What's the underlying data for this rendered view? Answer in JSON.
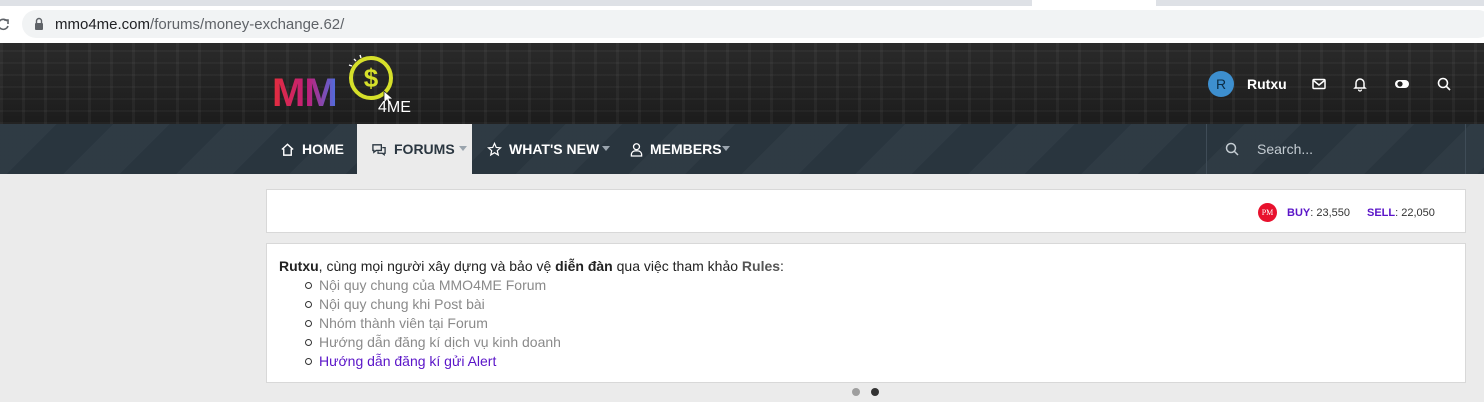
{
  "browser": {
    "url_host": "mmo4me.com",
    "url_path": "/forums/money-exchange.62/"
  },
  "header": {
    "logo_mm": "MM",
    "logo_4me": "4ME",
    "avatar_letter": "R",
    "username": "Rutxu",
    "icons": [
      "envelope-icon",
      "bell-icon",
      "toggle-icon",
      "search-icon"
    ]
  },
  "nav": {
    "items": [
      {
        "label": "HOME",
        "icon": "home-icon"
      },
      {
        "label": "FORUMS",
        "icon": "chat-icon",
        "active": true
      },
      {
        "label": "WHAT'S NEW",
        "icon": "star-icon"
      },
      {
        "label": "MEMBERS",
        "icon": "user-icon"
      }
    ],
    "search_placeholder": "Search..."
  },
  "rates": {
    "pm_label": "PM",
    "buy_label": "BUY",
    "buy_value": ": 23,550",
    "sell_label": "SELL",
    "sell_value": ": 22,050"
  },
  "notice": {
    "user": "Rutxu",
    "text_1": ", cùng mọi người xây dựng và bảo vệ ",
    "forum": "diễn đàn",
    "text_2": " qua việc tham khảo ",
    "rules": "Rules",
    "colon": ":",
    "items": [
      "Nội quy chung của MMO4ME Forum",
      "Nội quy chung khi Post bài",
      "Nhóm thành viên tại Forum",
      "Hướng dẫn đăng kí dịch vụ kinh doanh",
      "Hướng dẫn đăng kí gửi Alert"
    ]
  },
  "carousel": {
    "count": 2,
    "active_index": 1
  },
  "colors": {
    "nav_bg": "#2a3640",
    "accent_purple": "#5a14c8",
    "pm_red": "#e8112d",
    "avatar_blue": "#3d8fcf"
  }
}
